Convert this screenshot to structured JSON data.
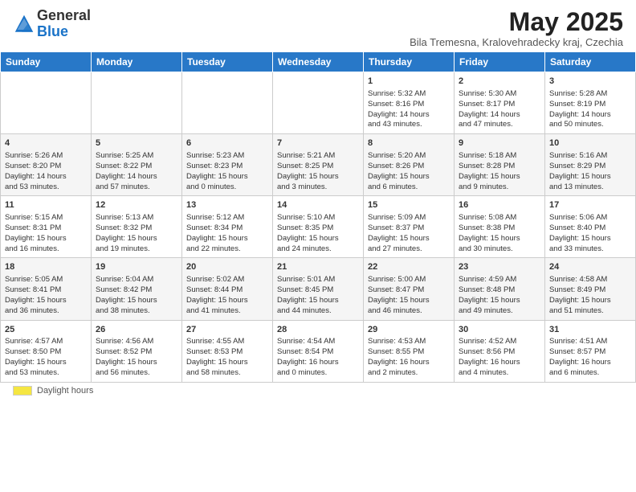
{
  "header": {
    "logo_general": "General",
    "logo_blue": "Blue",
    "month_title": "May 2025",
    "subtitle": "Bila Tremesna, Kralovehradecky kraj, Czechia"
  },
  "days_of_week": [
    "Sunday",
    "Monday",
    "Tuesday",
    "Wednesday",
    "Thursday",
    "Friday",
    "Saturday"
  ],
  "weeks": [
    [
      {
        "day": "",
        "info": ""
      },
      {
        "day": "",
        "info": ""
      },
      {
        "day": "",
        "info": ""
      },
      {
        "day": "",
        "info": ""
      },
      {
        "day": "1",
        "info": "Sunrise: 5:32 AM\nSunset: 8:16 PM\nDaylight: 14 hours\nand 43 minutes."
      },
      {
        "day": "2",
        "info": "Sunrise: 5:30 AM\nSunset: 8:17 PM\nDaylight: 14 hours\nand 47 minutes."
      },
      {
        "day": "3",
        "info": "Sunrise: 5:28 AM\nSunset: 8:19 PM\nDaylight: 14 hours\nand 50 minutes."
      }
    ],
    [
      {
        "day": "4",
        "info": "Sunrise: 5:26 AM\nSunset: 8:20 PM\nDaylight: 14 hours\nand 53 minutes."
      },
      {
        "day": "5",
        "info": "Sunrise: 5:25 AM\nSunset: 8:22 PM\nDaylight: 14 hours\nand 57 minutes."
      },
      {
        "day": "6",
        "info": "Sunrise: 5:23 AM\nSunset: 8:23 PM\nDaylight: 15 hours\nand 0 minutes."
      },
      {
        "day": "7",
        "info": "Sunrise: 5:21 AM\nSunset: 8:25 PM\nDaylight: 15 hours\nand 3 minutes."
      },
      {
        "day": "8",
        "info": "Sunrise: 5:20 AM\nSunset: 8:26 PM\nDaylight: 15 hours\nand 6 minutes."
      },
      {
        "day": "9",
        "info": "Sunrise: 5:18 AM\nSunset: 8:28 PM\nDaylight: 15 hours\nand 9 minutes."
      },
      {
        "day": "10",
        "info": "Sunrise: 5:16 AM\nSunset: 8:29 PM\nDaylight: 15 hours\nand 13 minutes."
      }
    ],
    [
      {
        "day": "11",
        "info": "Sunrise: 5:15 AM\nSunset: 8:31 PM\nDaylight: 15 hours\nand 16 minutes."
      },
      {
        "day": "12",
        "info": "Sunrise: 5:13 AM\nSunset: 8:32 PM\nDaylight: 15 hours\nand 19 minutes."
      },
      {
        "day": "13",
        "info": "Sunrise: 5:12 AM\nSunset: 8:34 PM\nDaylight: 15 hours\nand 22 minutes."
      },
      {
        "day": "14",
        "info": "Sunrise: 5:10 AM\nSunset: 8:35 PM\nDaylight: 15 hours\nand 24 minutes."
      },
      {
        "day": "15",
        "info": "Sunrise: 5:09 AM\nSunset: 8:37 PM\nDaylight: 15 hours\nand 27 minutes."
      },
      {
        "day": "16",
        "info": "Sunrise: 5:08 AM\nSunset: 8:38 PM\nDaylight: 15 hours\nand 30 minutes."
      },
      {
        "day": "17",
        "info": "Sunrise: 5:06 AM\nSunset: 8:40 PM\nDaylight: 15 hours\nand 33 minutes."
      }
    ],
    [
      {
        "day": "18",
        "info": "Sunrise: 5:05 AM\nSunset: 8:41 PM\nDaylight: 15 hours\nand 36 minutes."
      },
      {
        "day": "19",
        "info": "Sunrise: 5:04 AM\nSunset: 8:42 PM\nDaylight: 15 hours\nand 38 minutes."
      },
      {
        "day": "20",
        "info": "Sunrise: 5:02 AM\nSunset: 8:44 PM\nDaylight: 15 hours\nand 41 minutes."
      },
      {
        "day": "21",
        "info": "Sunrise: 5:01 AM\nSunset: 8:45 PM\nDaylight: 15 hours\nand 44 minutes."
      },
      {
        "day": "22",
        "info": "Sunrise: 5:00 AM\nSunset: 8:47 PM\nDaylight: 15 hours\nand 46 minutes."
      },
      {
        "day": "23",
        "info": "Sunrise: 4:59 AM\nSunset: 8:48 PM\nDaylight: 15 hours\nand 49 minutes."
      },
      {
        "day": "24",
        "info": "Sunrise: 4:58 AM\nSunset: 8:49 PM\nDaylight: 15 hours\nand 51 minutes."
      }
    ],
    [
      {
        "day": "25",
        "info": "Sunrise: 4:57 AM\nSunset: 8:50 PM\nDaylight: 15 hours\nand 53 minutes."
      },
      {
        "day": "26",
        "info": "Sunrise: 4:56 AM\nSunset: 8:52 PM\nDaylight: 15 hours\nand 56 minutes."
      },
      {
        "day": "27",
        "info": "Sunrise: 4:55 AM\nSunset: 8:53 PM\nDaylight: 15 hours\nand 58 minutes."
      },
      {
        "day": "28",
        "info": "Sunrise: 4:54 AM\nSunset: 8:54 PM\nDaylight: 16 hours\nand 0 minutes."
      },
      {
        "day": "29",
        "info": "Sunrise: 4:53 AM\nSunset: 8:55 PM\nDaylight: 16 hours\nand 2 minutes."
      },
      {
        "day": "30",
        "info": "Sunrise: 4:52 AM\nSunset: 8:56 PM\nDaylight: 16 hours\nand 4 minutes."
      },
      {
        "day": "31",
        "info": "Sunrise: 4:51 AM\nSunset: 8:57 PM\nDaylight: 16 hours\nand 6 minutes."
      }
    ]
  ],
  "footer": {
    "daylight_label": "Daylight hours"
  }
}
